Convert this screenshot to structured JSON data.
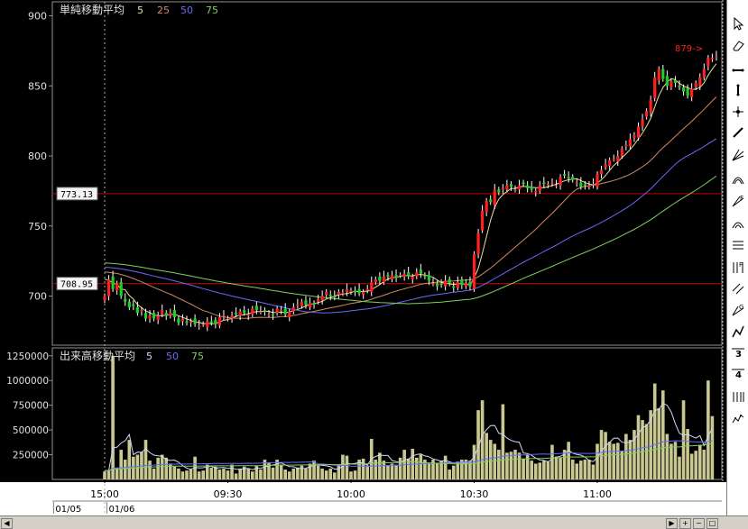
{
  "chart_data": {
    "type": "candlestick",
    "price_panel": {
      "title": "単純移動平均",
      "ma_labels": [
        "5",
        "25",
        "50",
        "75"
      ],
      "ylim": [
        665,
        910
      ],
      "yticks": [
        700,
        750,
        800,
        850,
        900
      ],
      "hlines": [
        {
          "label": "773.13",
          "value": 773.13
        },
        {
          "label": "708.95",
          "value": 708.95
        }
      ],
      "last_price_label": "879->"
    },
    "volume_panel": {
      "title": "出来高移動平均",
      "ma_labels": [
        "5",
        "50",
        "75"
      ],
      "ylim": [
        0,
        1330000
      ],
      "yticks": [
        250000,
        500000,
        750000,
        1000000,
        1250000
      ],
      "ytick_labels": [
        "250000",
        "500000",
        "750000",
        "1000000",
        "1250000"
      ]
    },
    "x_axis": {
      "time_ticks": [
        {
          "label": "15:00",
          "bar": 0
        },
        {
          "label": "09:30",
          "bar": 30
        },
        {
          "label": "10:00",
          "bar": 60
        },
        {
          "label": "10:30",
          "bar": 90
        },
        {
          "label": "11:00",
          "bar": 120
        }
      ],
      "date_labels": [
        {
          "label": "01/05",
          "bar": -12
        },
        {
          "label": "01/06",
          "bar": 1
        }
      ],
      "bars_shown": 149
    },
    "prices": [
      700,
      712,
      705,
      709,
      700,
      696,
      692,
      693,
      688,
      690,
      684,
      686,
      684,
      686,
      690,
      686,
      688,
      685,
      681,
      684,
      681,
      682,
      680,
      679,
      680,
      682,
      681,
      680,
      685,
      686,
      684,
      686,
      687,
      689,
      688,
      687,
      691,
      690,
      689,
      689,
      687,
      686,
      691,
      690,
      687,
      689,
      692,
      694,
      696,
      694,
      695,
      694,
      698,
      700,
      703,
      700,
      699,
      703,
      702,
      705,
      704,
      703,
      702,
      703,
      705,
      710,
      712,
      711,
      714,
      714,
      715,
      713,
      715,
      716,
      714,
      714,
      717,
      716,
      714,
      711,
      709,
      707,
      708,
      711,
      709,
      706,
      710,
      708,
      709,
      707,
      730,
      745,
      761,
      768,
      767,
      776,
      774,
      777,
      779,
      778,
      776,
      779,
      780,
      777,
      776,
      775,
      779,
      780,
      780,
      781,
      779,
      785,
      786,
      784,
      783,
      781,
      778,
      779,
      779,
      780,
      787,
      790,
      794,
      797,
      798,
      800,
      805,
      808,
      812,
      815,
      821,
      826,
      832,
      840,
      856,
      862,
      855,
      850,
      853,
      852,
      849,
      846,
      843,
      848,
      852,
      856,
      862,
      870,
      870,
      871
    ],
    "volumes": [
      80000,
      90000,
      1250000,
      120000,
      300000,
      200000,
      400000,
      230000,
      250000,
      280000,
      400000,
      190000,
      110000,
      220000,
      250000,
      220000,
      160000,
      130000,
      110000,
      80000,
      90000,
      100000,
      230000,
      80000,
      90000,
      150000,
      120000,
      130000,
      100000,
      110000,
      90000,
      150000,
      60000,
      110000,
      130000,
      110000,
      80000,
      140000,
      100000,
      200000,
      170000,
      120000,
      200000,
      150000,
      100000,
      80000,
      110000,
      120000,
      140000,
      110000,
      160000,
      190000,
      140000,
      110000,
      90000,
      110000,
      70000,
      150000,
      250000,
      240000,
      80000,
      90000,
      200000,
      210000,
      140000,
      410000,
      200000,
      270000,
      190000,
      140000,
      160000,
      140000,
      220000,
      300000,
      210000,
      310000,
      220000,
      250000,
      200000,
      170000,
      200000,
      160000,
      190000,
      240000,
      100000,
      140000,
      180000,
      200000,
      200000,
      190000,
      350000,
      700000,
      800000,
      470000,
      400000,
      360000,
      300000,
      760000,
      270000,
      280000,
      300000,
      270000,
      210000,
      250000,
      190000,
      160000,
      170000,
      190000,
      180000,
      350000,
      230000,
      220000,
      300000,
      380000,
      200000,
      160000,
      190000,
      200000,
      200000,
      150000,
      360000,
      500000,
      480000,
      380000,
      360000,
      370000,
      290000,
      460000,
      400000,
      500000,
      650000,
      600000,
      560000,
      700000,
      970000,
      720000,
      900000,
      460000,
      360000,
      380000,
      230000,
      800000,
      510000,
      260000,
      290000,
      350000,
      300000,
      1000000,
      640000
    ],
    "colors": {
      "up": "#ff2020",
      "down": "#20d020",
      "ma5": "#e8e0a0",
      "ma25": "#d08a60",
      "ma50": "#6a6aff",
      "ma75": "#80d060",
      "vol_bar": "#c8c890",
      "vol_ma5": "#d0d8ff",
      "vol_ma50": "#6a6aff",
      "vol_ma75": "#80d060",
      "hline": "#c00000",
      "axis_text": "#e0e0e0",
      "frame": "#909090"
    }
  },
  "toolbar": {
    "tools": [
      {
        "name": "cursor-tool-button",
        "icon": "cursor-icon"
      },
      {
        "name": "eraser-tool-button",
        "icon": "eraser-icon"
      },
      {
        "name": "horizontal-line-tool-button",
        "icon": "horizontal-line-icon"
      },
      {
        "name": "vertical-line-tool-button",
        "icon": "vertical-line-icon"
      },
      {
        "name": "cross-line-tool-button",
        "icon": "crosshair-icon"
      },
      {
        "name": "trend-line-tool-button",
        "icon": "trend-line-icon"
      },
      {
        "name": "fan-line-tool-button",
        "icon": "fan-icon"
      },
      {
        "name": "arc-tool-button",
        "icon": "arc-icon"
      },
      {
        "name": "fibonacci-fan-tool-button",
        "icon": "fibonacci-fan-icon"
      },
      {
        "name": "fibonacci-arc-tool-button",
        "icon": "fibonacci-arc-icon"
      },
      {
        "name": "fibonacci-retracement-tool-button",
        "icon": "fibonacci-retracement-icon"
      },
      {
        "name": "fibonacci-time-tool-button",
        "icon": "fibonacci-time-icon"
      },
      {
        "name": "parallel-line-tool-button",
        "icon": "parallel-line-icon"
      },
      {
        "name": "gann-fan-tool-button",
        "icon": "gann-fan-icon"
      },
      {
        "name": "zigzag-tool-button",
        "icon": "zigzag-icon"
      },
      {
        "name": "three-point-tool-button",
        "icon": "three-point-icon"
      },
      {
        "name": "four-point-tool-button",
        "icon": "four-point-icon"
      },
      {
        "name": "cycle-line-tool-button",
        "icon": "cycle-line-icon"
      },
      {
        "name": "wave-tool-button",
        "icon": "wave-icon"
      }
    ]
  },
  "scrollbar": {
    "left_arrow": "◀",
    "right_arrow": "▶",
    "plus": "+",
    "minus": "−",
    "reset": "□"
  }
}
